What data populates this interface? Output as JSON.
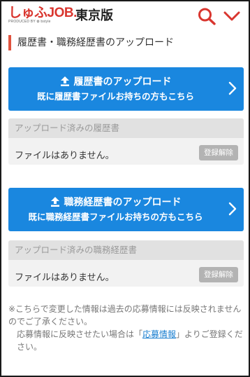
{
  "header": {
    "logo_kana": "しゅふ",
    "logo_job": "JOB.",
    "logo_sub": "PRODUCED BY ✿ bstyle",
    "area": "東京版",
    "accent_color": "#d9362f",
    "icons": [
      "search-icon",
      "chevron-down-icon"
    ]
  },
  "section": {
    "title": "履歴書・職務経歴書のアップロード"
  },
  "resume": {
    "button_line1": "履歴書のアップロード",
    "button_line2": "既に履歴書ファイルお持ちの方もこちら",
    "panel_title": "アップロード済みの履歴書",
    "status": "ファイルはありません。",
    "unregister_label": "登録解除"
  },
  "career": {
    "button_line1": "職務経歴書のアップロード",
    "button_line2": "既に職務経歴書ファイルお持ちの方もこちら",
    "panel_title": "アップロード済みの職務経歴書",
    "status": "ファイルはありません。",
    "unregister_label": "登録解除"
  },
  "note": {
    "line1": "※こちらで変更した情報は過去の応募情報には反映されませんのでご了承ください。",
    "line2_pre": "応募情報に反映させたい場合は「",
    "line2_link": "応募情報",
    "line2_post": "」よりご登録ください。"
  },
  "colors": {
    "primary_button": "#1a87df",
    "panel_header": "#e1e1e1",
    "disabled_button": "#b3b3b3",
    "link": "#1a7fd0"
  }
}
